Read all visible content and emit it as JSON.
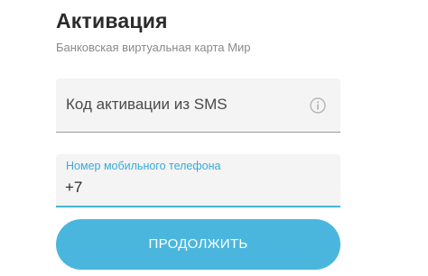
{
  "header": {
    "title": "Активация",
    "subtitle": "Банковская виртуальная карта Мир"
  },
  "activation_code": {
    "placeholder": "Код активации из SMS",
    "icon": "info-icon"
  },
  "phone": {
    "label": "Номер мобильного телефона",
    "value": "+7"
  },
  "continue_button": {
    "label": "ПРОДОЛЖИТЬ"
  },
  "colors": {
    "accent": "#4ab6dd",
    "label_accent": "#3aaad6",
    "field_bg": "#f4f4f4",
    "title": "#2b2b2b",
    "subtitle": "#8a8a8a"
  }
}
